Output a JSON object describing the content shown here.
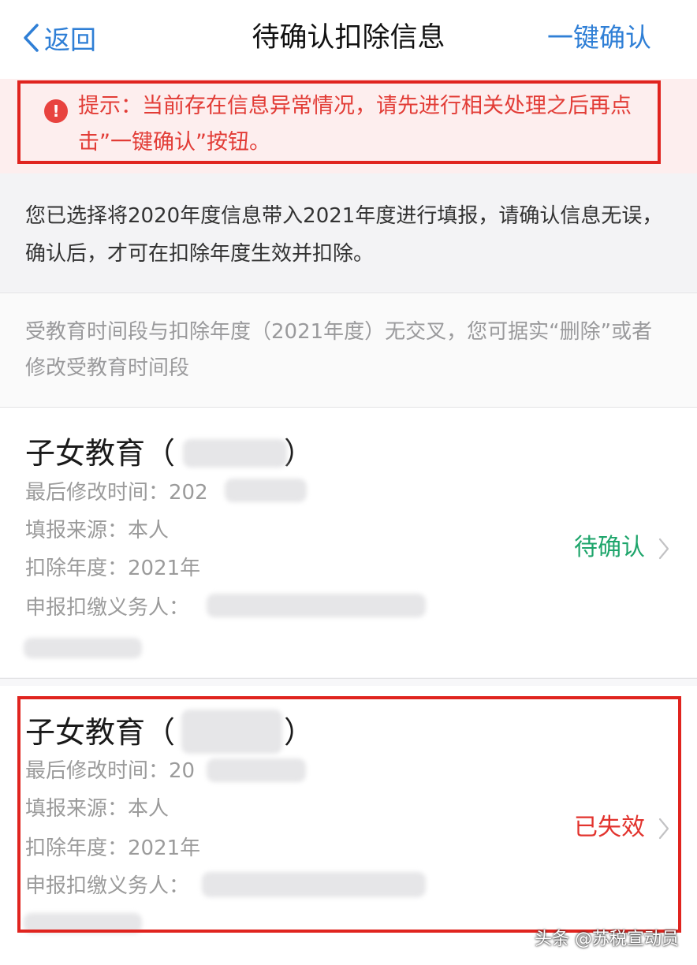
{
  "nav": {
    "back_label": "返回",
    "title": "待确认扣除信息",
    "action_label": "一键确认"
  },
  "alert": {
    "text": "提示：当前存在信息异常情况，请先进行相关处理之后再点击”一键确认”按钮。"
  },
  "info": {
    "text": "您已选择将2020年度信息带入2021年度进行填报，请确认信息无误，确认后，才可在扣除年度生效并扣除。"
  },
  "notice": {
    "text": "受教育时间段与扣除年度（2021年度）无交叉，您可据实“删除”或者修改受教育时间段"
  },
  "cards": [
    {
      "title": "子女教育（",
      "title_close": "）",
      "modified_label": "最后修改时间：",
      "modified_value": "202",
      "source": "填报来源：本人",
      "year": "扣除年度：2021年",
      "agent_label": "申报扣缴义务人：",
      "status": "待确认",
      "status_color": "#1ea56b"
    },
    {
      "title": "子女教育（",
      "title_close": "）",
      "modified_label": "最后修改时间：",
      "modified_value": "20",
      "source": "填报来源：本人",
      "year": "扣除年度：2021年",
      "agent_label": "申报扣缴义务人：",
      "status": "已失效",
      "status_color": "#e2332d"
    }
  ],
  "colors": {
    "accent": "#2f7fd6",
    "alert_red": "#e0241f"
  },
  "watermark": "头条 @苏税宣动员"
}
